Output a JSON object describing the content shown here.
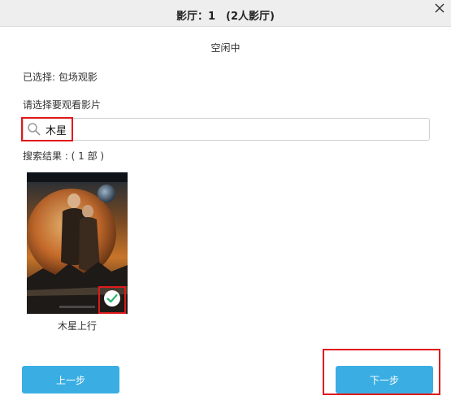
{
  "dialog": {
    "title": "影厅：1　(2人影厅)",
    "status": "空闲中",
    "selected_text": "已选择: 包场观影",
    "prompt": "请选择要观看影片",
    "search": {
      "value": "木星",
      "placeholder": ""
    },
    "results_label": "搜索结果 : ( 1 部 )",
    "movies": [
      {
        "title": "木星上行",
        "selected": true
      }
    ],
    "buttons": {
      "prev": "上一步",
      "next": "下一步"
    }
  },
  "colors": {
    "accent": "#3aaee3",
    "highlight": "#e0191b",
    "check": "#2bb573",
    "titlebar": "#eeeeee"
  },
  "icons": [
    "close-icon",
    "search-icon",
    "check-icon"
  ]
}
